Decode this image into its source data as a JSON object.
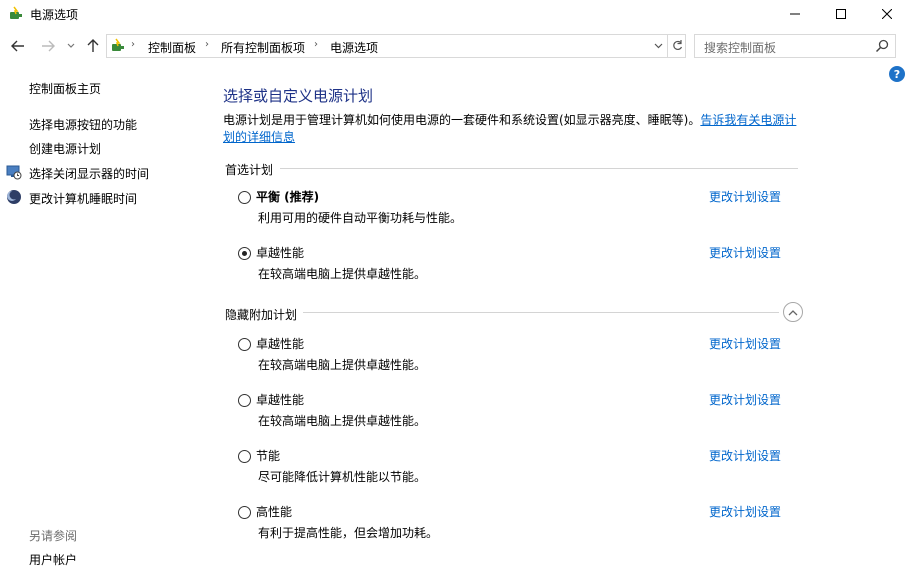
{
  "window": {
    "title": "电源选项",
    "app_icon": "power-options-icon",
    "controls": {
      "minimize": "minimize-icon",
      "maximize": "maximize-icon",
      "close": "close-icon"
    }
  },
  "navigation": {
    "breadcrumbs": [
      "控制面板",
      "所有控制面板项",
      "电源选项"
    ],
    "search_placeholder": "搜索控制面板"
  },
  "sidebar": {
    "home": "控制面板主页",
    "links": [
      {
        "label": "选择电源按钮的功能",
        "icon": ""
      },
      {
        "label": "创建电源计划",
        "icon": ""
      },
      {
        "label": "选择关闭显示器的时间",
        "icon": "monitor-clock-icon"
      },
      {
        "label": "更改计算机睡眠时间",
        "icon": "sleep-moon-icon"
      }
    ],
    "see_also_heading": "另请参阅",
    "see_also_links": [
      "用户帐户"
    ]
  },
  "main": {
    "title": "选择或自定义电源计划",
    "intro": "电源计划是用于管理计算机如何使用电源的一套硬件和系统设置(如显示器亮度、睡眠等)。",
    "intro_link": "告诉我有关电源计划的详细信息",
    "preferred_heading": "首选计划",
    "hidden_heading": "隐藏附加计划",
    "change_link": "更改计划设置",
    "preferred_plans": [
      {
        "name": "平衡 (推荐)",
        "description": "利用可用的硬件自动平衡功耗与性能。",
        "selected": false
      },
      {
        "name": "卓越性能",
        "description": "在较高端电脑上提供卓越性能。",
        "selected": true
      }
    ],
    "hidden_plans": [
      {
        "name": "卓越性能",
        "description": "在较高端电脑上提供卓越性能。",
        "selected": false
      },
      {
        "name": "卓越性能",
        "description": "在较高端电脑上提供卓越性能。",
        "selected": false
      },
      {
        "name": "节能",
        "description": "尽可能降低计算机性能以节能。",
        "selected": false
      },
      {
        "name": "高性能",
        "description": "有利于提高性能，但会增加功耗。",
        "selected": false
      }
    ]
  }
}
